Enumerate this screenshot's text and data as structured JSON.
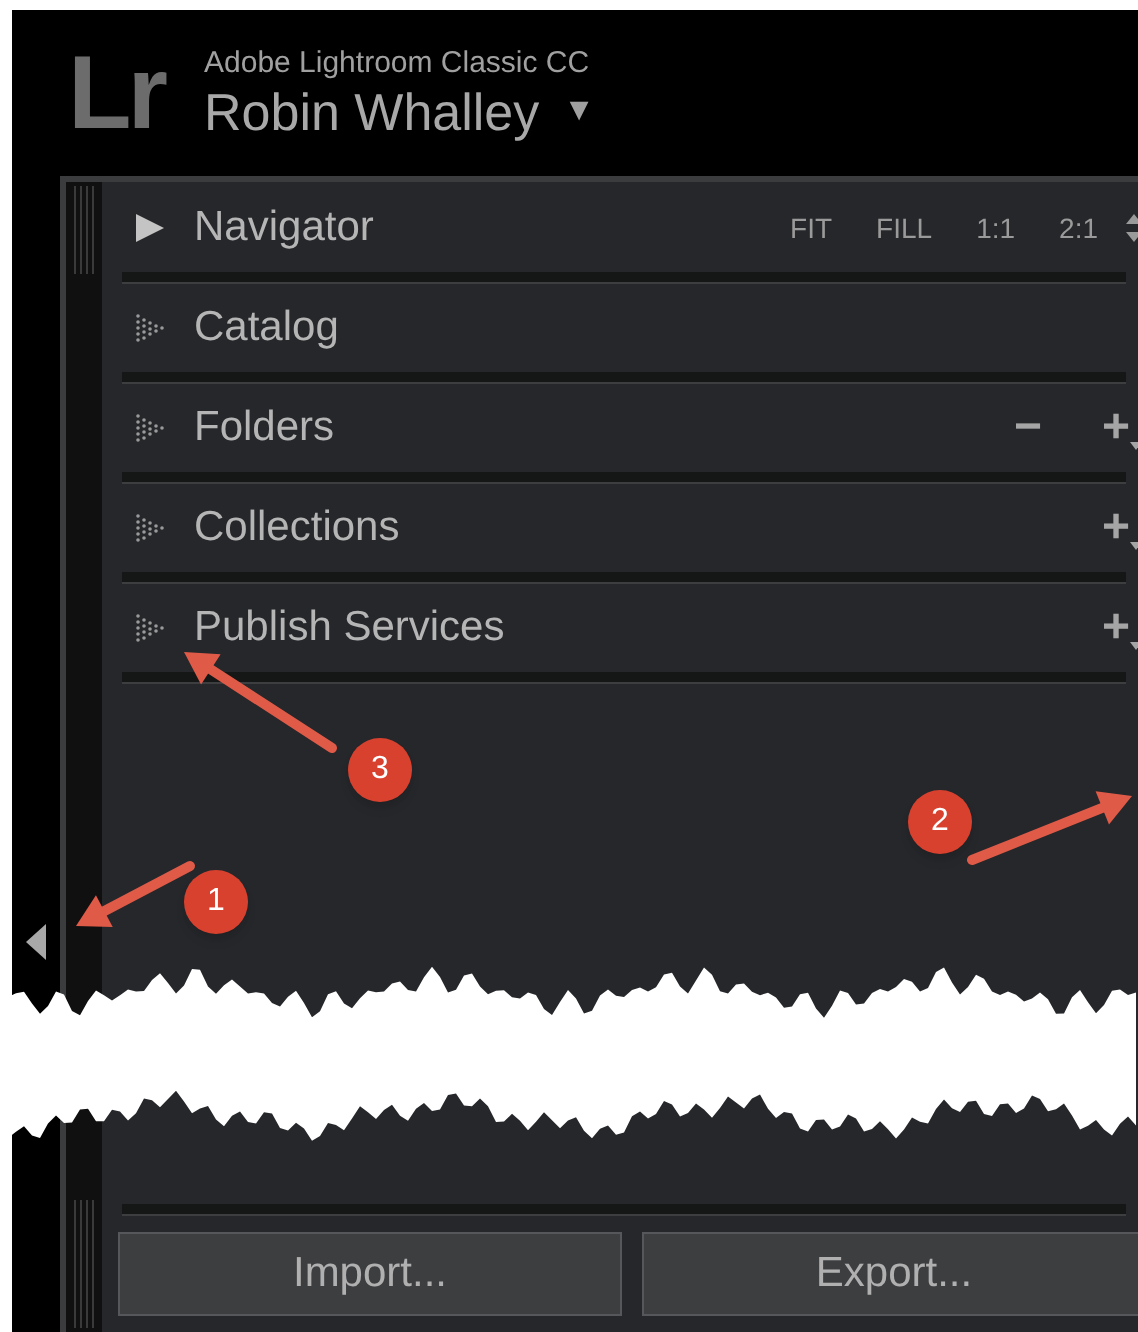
{
  "header": {
    "logo": "Lr",
    "product": "Adobe Lightroom Classic CC",
    "user": "Robin Whalley",
    "menu_arrow": "▼"
  },
  "panels": [
    {
      "title": "Navigator",
      "populated": true,
      "zoom_options": [
        "FIT",
        "FILL",
        "1:1",
        "2:1"
      ]
    },
    {
      "title": "Catalog",
      "populated": false
    },
    {
      "title": "Folders",
      "populated": false,
      "actions": [
        "−",
        "+"
      ]
    },
    {
      "title": "Collections",
      "populated": false,
      "actions": [
        "+"
      ]
    },
    {
      "title": "Publish Services",
      "populated": false,
      "actions": [
        "+"
      ]
    }
  ],
  "buttons": [
    "Import...",
    "Export..."
  ],
  "annotations": [
    {
      "label": "1"
    },
    {
      "label": "2"
    },
    {
      "label": "3"
    }
  ]
}
